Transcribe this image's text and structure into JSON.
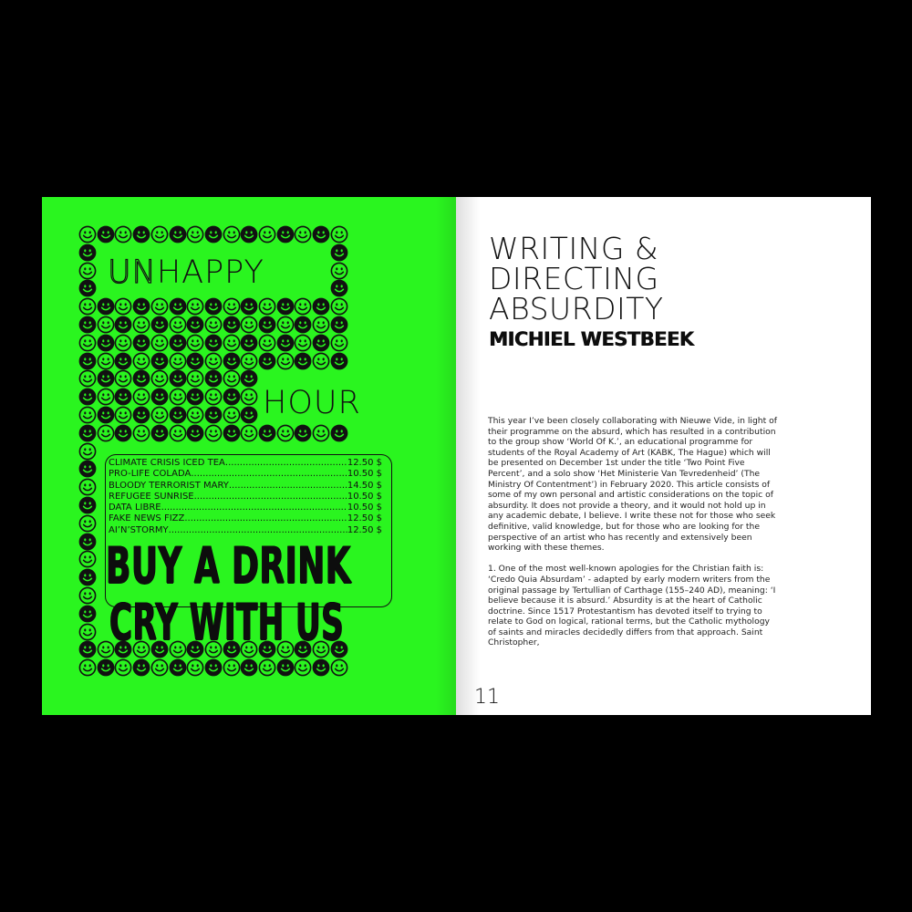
{
  "left_page": {
    "title_top_outline": "UN",
    "title_top_solid": "HAPPY",
    "title_bottom": "HOUR",
    "menu": [
      {
        "name": "CLIMATE CRISIS ICED TEA",
        "price": "12.50 $"
      },
      {
        "name": "PRO-LIFE COLADA",
        "price": "10.50 $"
      },
      {
        "name": "BLOODY TERRORIST MARY",
        "price": "14.50 $"
      },
      {
        "name": "REFUGEE SUNRISE",
        "price": "10.50 $"
      },
      {
        "name": "DATA LIBRE",
        "price": "10.50 $"
      },
      {
        "name": "FAKE NEWS FIZZ",
        "price": "12.50 $"
      },
      {
        "name": "AI’N’STORMY",
        "price": "12.50 $"
      }
    ],
    "slogan_line1": "BUY A DRINK",
    "slogan_line2": "CRY WITH US",
    "page_number": "11",
    "smiley_icon": "smiley-face-icon"
  },
  "right_page": {
    "title_lines": [
      "WRITING &",
      "DIRECTING",
      "ABSURDITY"
    ],
    "author": "MICHIEL WESTBEEK",
    "paragraphs": [
      "This year I’ve been closely collaborating with Nieuwe Vide, in light of their programme on the absurd, which  has resulted in a contribution to the group show ‘World Of K.’, an educational programme for students of the Royal Academy of Art (KABK, The Hague) which will  be presented on December 1st under the title ‘Two Point Five Percent’, and a solo show ‘Het Ministerie Van Tevredenheid’ (The Ministry Of Contentment’) in February 2020. This article consists of some of my own personal and artistic considerations on the topic of absurdity. It does not provide a theory, and it would not hold up in any academic debate, I believe. I write these not for those who seek definitive, valid knowledge, but for those who are looking for the perspective of an artist who has recently and extensively been working with these themes.",
      "1. One of the most well-known apologies for the Christian faith is: ‘Credo Quia Absurdam’ - adapted by early modern writers from the original passage by Tertullian of Carthage (155–240 AD), meaning: ‘I believe because it is absurd.’ Absurdity is at the heart of Catholic doctrine. Since 1517 Protestantism has devoted itself to trying to relate to God on logical, rational terms, but the Catholic mythology of saints and miracles decidedly differs from that approach. Saint Christopher,"
    ]
  },
  "colors": {
    "neon_green": "#2af51f",
    "ink": "#111111",
    "page_white": "#ffffff",
    "background": "#000000"
  }
}
